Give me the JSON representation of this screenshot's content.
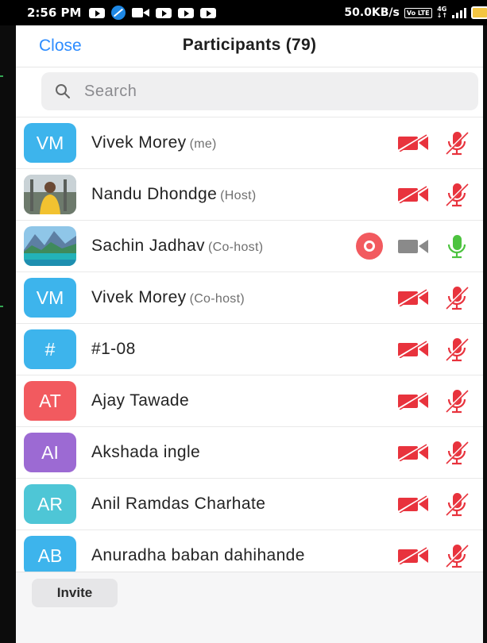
{
  "status_bar": {
    "time": "2:56 PM",
    "speed": "50.0KB/s",
    "volte": "Vo LTE",
    "network": "4G",
    "icons": [
      "youtube-icon",
      "blocked-icon",
      "video-icon",
      "youtube-icon",
      "youtube-icon",
      "youtube-icon",
      "signal-icon",
      "battery-icon"
    ]
  },
  "header": {
    "close_label": "Close",
    "title": "Participants (79)"
  },
  "search": {
    "placeholder": "Search"
  },
  "participants": [
    {
      "initials": "VM",
      "name": "Vivek Morey",
      "role": "(me)",
      "avatar_color": "#3db4ec",
      "video": "off",
      "audio": "muted"
    },
    {
      "initials": "",
      "name": "Nandu Dhondge",
      "role": "(Host)",
      "avatar": "photo-person-yellow-shirt",
      "video": "off",
      "audio": "muted"
    },
    {
      "initials": "",
      "name": "Sachin Jadhav",
      "role": "(Co-host)",
      "avatar": "photo-landscape-lake",
      "recording": true,
      "video": "off-grey",
      "audio": "on"
    },
    {
      "initials": "VM",
      "name": "Vivek Morey",
      "role": "(Co-host)",
      "avatar_color": "#3db4ec",
      "video": "off",
      "audio": "muted"
    },
    {
      "initials": "#",
      "name": "#1-08",
      "role": "",
      "avatar_color": "#3db4ec",
      "video": "off",
      "audio": "muted"
    },
    {
      "initials": "AT",
      "name": "Ajay Tawade",
      "role": "",
      "avatar_color": "#f25a5f",
      "video": "off",
      "audio": "muted"
    },
    {
      "initials": "AI",
      "name": "Akshada ingle",
      "role": "",
      "avatar_color": "#9c6ad3",
      "video": "off",
      "audio": "muted"
    },
    {
      "initials": "AR",
      "name": "Anil Ramdas Charhate",
      "role": "",
      "avatar_color": "#4ec6d6",
      "video": "off",
      "audio": "muted"
    },
    {
      "initials": "AB",
      "name": "Anuradha baban dahihande",
      "role": "",
      "avatar_color": "#3db4ec",
      "video": "off",
      "audio": "muted"
    }
  ],
  "footer": {
    "invite_label": "Invite"
  },
  "colors": {
    "accent": "#2d8cff",
    "muted_red": "#e8333d",
    "mic_on_green": "#4cc33f",
    "record_red": "#f25a5f"
  }
}
